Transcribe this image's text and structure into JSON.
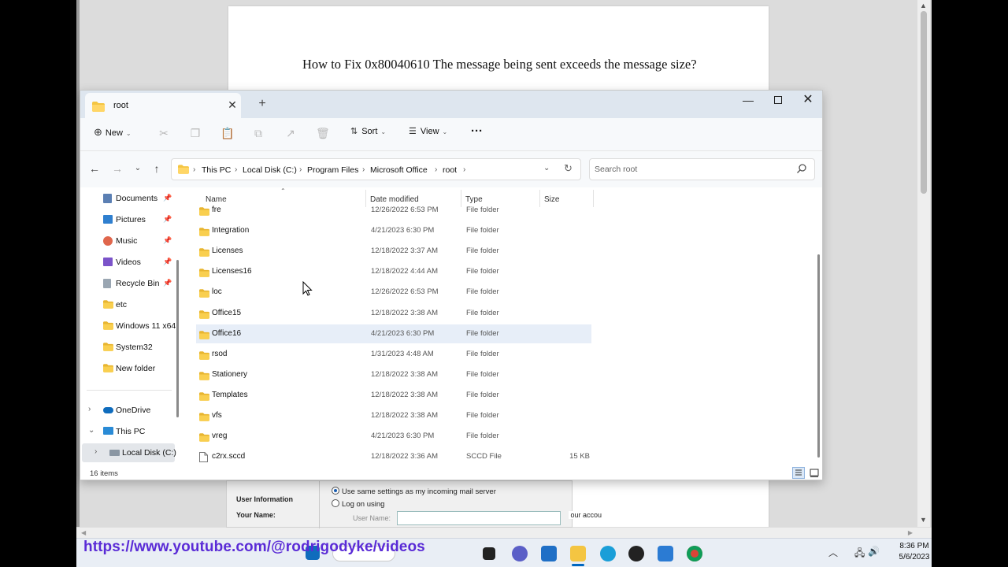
{
  "document": {
    "title": "How to Fix 0x80040610 The message being sent exceeds the message size?"
  },
  "dialog": {
    "user_information": "User Information",
    "your_name": "Your Name:",
    "radio_same_settings": "Use same settings as my incoming mail server",
    "radio_log_on": "Log on using",
    "user_name_label": "User Name:",
    "account_fragment": "our accou"
  },
  "explorer": {
    "tab_title": "root",
    "toolbar": {
      "new_label": "New",
      "sort_label": "Sort",
      "view_label": "View",
      "more_label": "···"
    },
    "breadcrumb": [
      "This PC",
      "Local Disk (C:)",
      "Program Files",
      "Microsoft Office",
      "root"
    ],
    "search_placeholder": "Search root",
    "nav_items": [
      {
        "label": "Documents",
        "icon": "documents-icon",
        "pinned": true
      },
      {
        "label": "Pictures",
        "icon": "pictures-icon",
        "pinned": true
      },
      {
        "label": "Music",
        "icon": "music-icon",
        "pinned": true
      },
      {
        "label": "Videos",
        "icon": "videos-icon",
        "pinned": true
      },
      {
        "label": "Recycle Bin",
        "icon": "recycle-bin-icon",
        "pinned": true
      },
      {
        "label": "etc",
        "icon": "folder-icon",
        "pinned": false
      },
      {
        "label": "Windows 11 x64",
        "icon": "folder-icon",
        "pinned": false
      },
      {
        "label": "System32",
        "icon": "folder-icon",
        "pinned": false
      },
      {
        "label": "New folder",
        "icon": "folder-icon",
        "pinned": false
      }
    ],
    "nav_tree": [
      {
        "label": "OneDrive",
        "icon": "onedrive-icon",
        "expander": "›"
      },
      {
        "label": "This PC",
        "icon": "this-pc-icon",
        "expander": "⌄"
      },
      {
        "label": "Local Disk (C:)",
        "icon": "drive-icon",
        "expander": "›"
      }
    ],
    "columns": {
      "name": "Name",
      "date": "Date modified",
      "type": "Type",
      "size": "Size"
    },
    "files": [
      {
        "name": "fre",
        "date": "12/26/2022 6:53 PM",
        "type": "File folder",
        "size": ""
      },
      {
        "name": "Integration",
        "date": "4/21/2023 6:30 PM",
        "type": "File folder",
        "size": ""
      },
      {
        "name": "Licenses",
        "date": "12/18/2022 3:37 AM",
        "type": "File folder",
        "size": ""
      },
      {
        "name": "Licenses16",
        "date": "12/18/2022 4:44 AM",
        "type": "File folder",
        "size": ""
      },
      {
        "name": "loc",
        "date": "12/26/2022 6:53 PM",
        "type": "File folder",
        "size": ""
      },
      {
        "name": "Office15",
        "date": "12/18/2022 3:38 AM",
        "type": "File folder",
        "size": ""
      },
      {
        "name": "Office16",
        "date": "4/21/2023 6:30 PM",
        "type": "File folder",
        "size": ""
      },
      {
        "name": "rsod",
        "date": "1/31/2023 4:48 AM",
        "type": "File folder",
        "size": ""
      },
      {
        "name": "Stationery",
        "date": "12/18/2022 3:38 AM",
        "type": "File folder",
        "size": ""
      },
      {
        "name": "Templates",
        "date": "12/18/2022 3:38 AM",
        "type": "File folder",
        "size": ""
      },
      {
        "name": "vfs",
        "date": "12/18/2022 3:38 AM",
        "type": "File folder",
        "size": ""
      },
      {
        "name": "vreg",
        "date": "4/21/2023 6:30 PM",
        "type": "File folder",
        "size": ""
      },
      {
        "name": "c2rx.sccd",
        "date": "12/18/2022 3:36 AM",
        "type": "SCCD File",
        "size": "15 KB"
      }
    ],
    "selected_file": "Office16",
    "status": "16 items"
  },
  "taskbar": {
    "overlay_url": "https://www.youtube.com/@rodrigodyke/videos",
    "time": "8:36 PM",
    "date": "5/6/2023"
  },
  "colors": {
    "folder": "#f4c542",
    "accent": "#0067c0",
    "selection": "#e7eef8",
    "url_overlay": "#5a2bd6"
  }
}
